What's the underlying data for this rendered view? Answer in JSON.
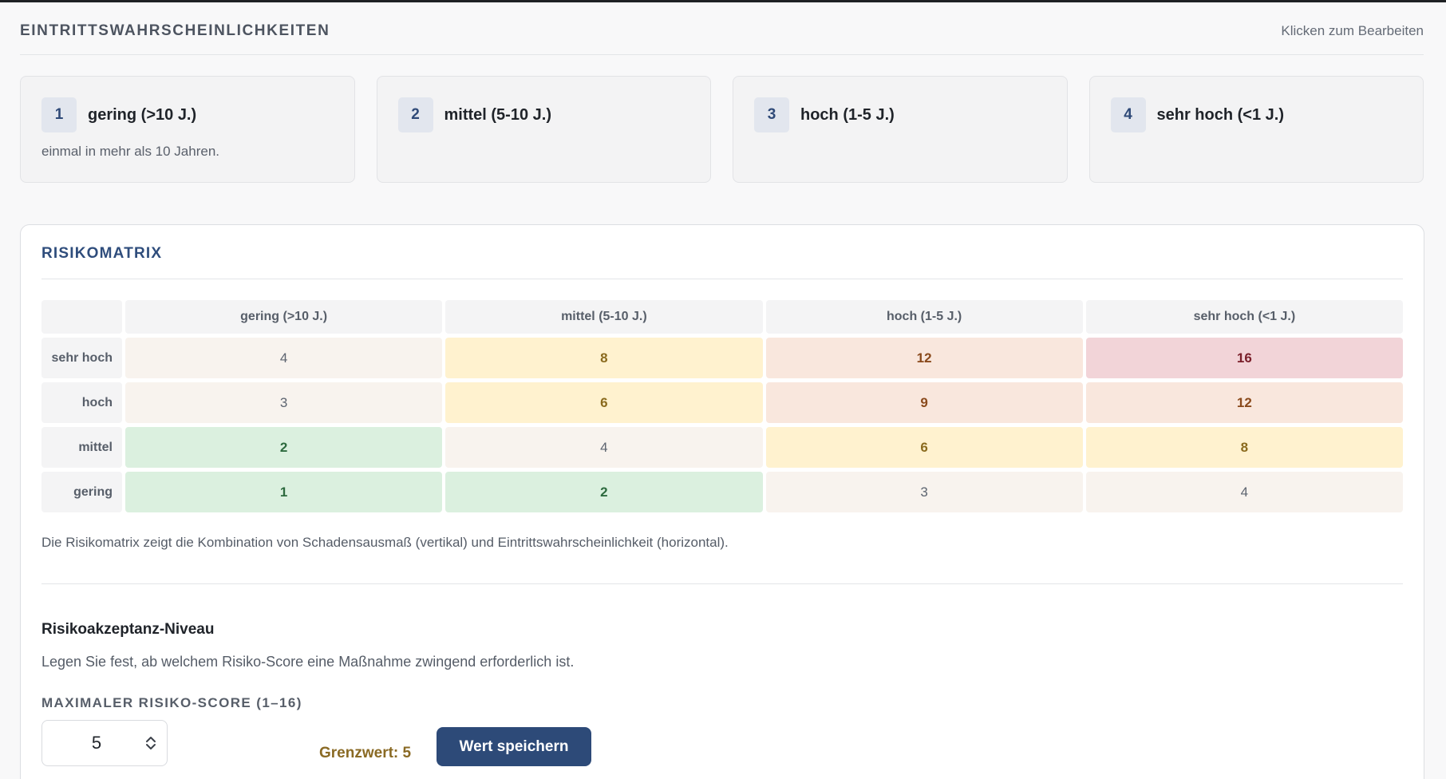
{
  "header": {
    "title": "EINTRITTSWAHRSCHEINLICHKEITEN",
    "edit_hint": "Klicken zum Bearbeiten"
  },
  "probabilities": [
    {
      "num": "1",
      "label": "gering (>10 J.)",
      "desc": "einmal in mehr als 10 Jahren."
    },
    {
      "num": "2",
      "label": "mittel (5-10 J.)",
      "desc": ""
    },
    {
      "num": "3",
      "label": "hoch (1-5 J.)",
      "desc": ""
    },
    {
      "num": "4",
      "label": "sehr hoch (<1 J.)",
      "desc": ""
    }
  ],
  "matrix": {
    "title": "RISIKOMATRIX",
    "columns": [
      "gering (>10 J.)",
      "mittel (5-10 J.)",
      "hoch (1-5 J.)",
      "sehr hoch (<1 J.)"
    ],
    "rows": [
      {
        "label": "sehr hoch",
        "cells": [
          "4",
          "8",
          "12",
          "16"
        ]
      },
      {
        "label": "hoch",
        "cells": [
          "3",
          "6",
          "9",
          "12"
        ]
      },
      {
        "label": "mittel",
        "cells": [
          "2",
          "4",
          "6",
          "8"
        ]
      },
      {
        "label": "gering",
        "cells": [
          "1",
          "2",
          "3",
          "4"
        ]
      }
    ],
    "note": "Die Risikomatrix zeigt die Kombination von Schadensausmaß (vertikal)  und Eintrittswahrscheinlichkeit (horizontal).",
    "colors": {
      "neutral": "#f8f3ee",
      "green": "#dbf0df",
      "yellow": "#fff2cf",
      "orange": "#f9e7dd",
      "red": "#f2d4d8"
    }
  },
  "acceptance": {
    "title": "Risikoakzeptanz-Niveau",
    "description": "Legen Sie fest, ab welchem Risiko-Score eine Maßnahme zwingend  erforderlich ist.",
    "score_label": "MAXIMALER RISIKO-SCORE (1–16)",
    "score_value": "5",
    "threshold_text": "Grenzwert: 5",
    "save_label": "Wert speichern",
    "accent_color": "#2d4a78"
  }
}
